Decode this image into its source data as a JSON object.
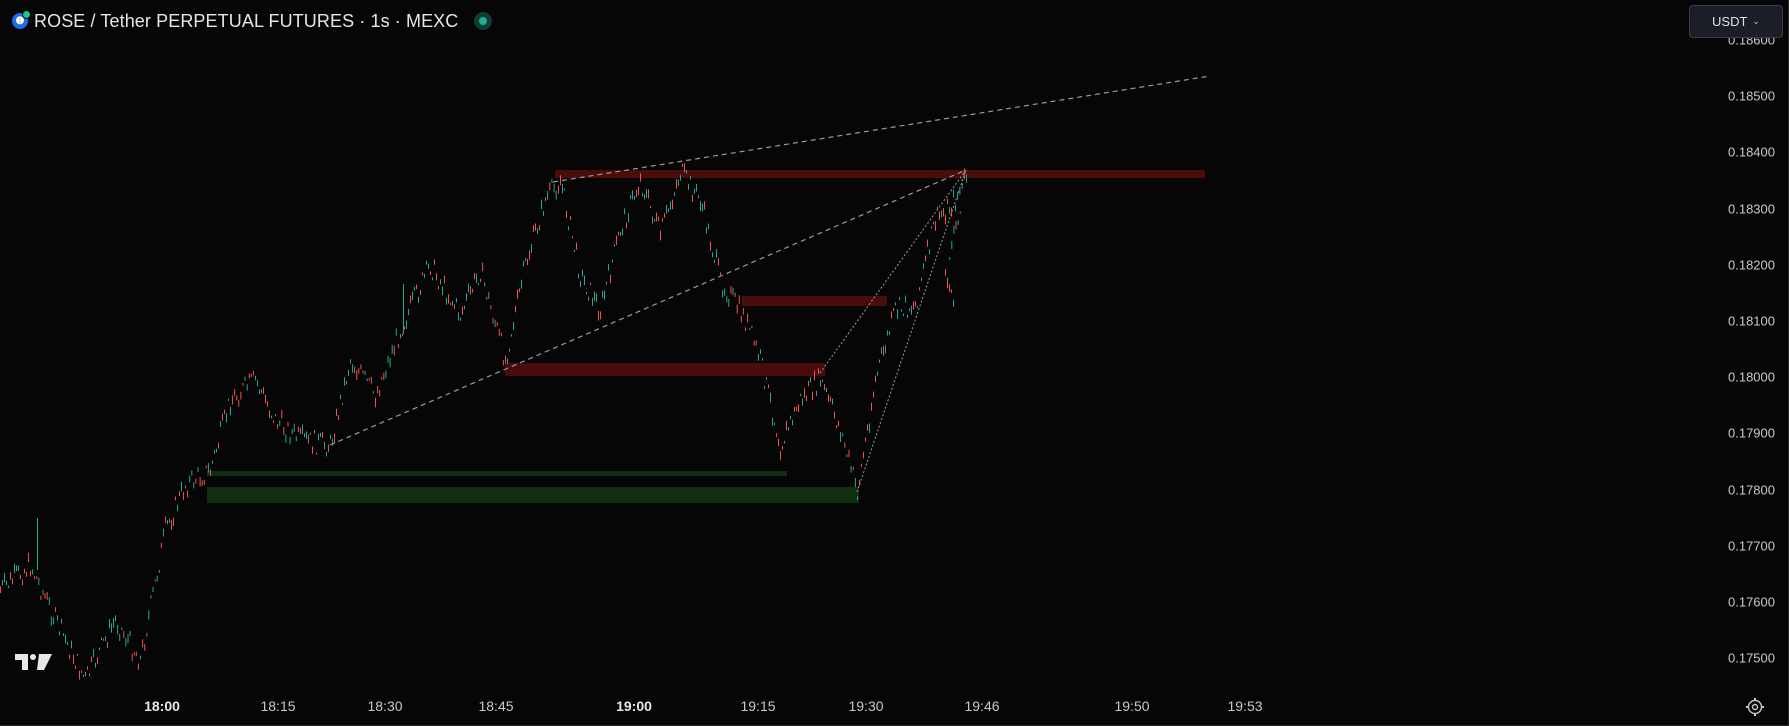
{
  "header": {
    "coin_icon": "rose-coin-icon",
    "coin_glyph": "❶",
    "symbol_title": "ROSE / Tether PERPETUAL FUTURES · 1s · MEXC",
    "live_indicator": "live-status-dot"
  },
  "price_axis": {
    "currency": "USDT",
    "ticks": [
      "0.18600",
      "0.18500",
      "0.18400",
      "0.18300",
      "0.18200",
      "0.18100",
      "0.18000",
      "0.17900",
      "0.17800",
      "0.17700",
      "0.17600",
      "0.17500"
    ]
  },
  "time_axis": {
    "ticks": [
      {
        "label": "18:00",
        "bold": true
      },
      {
        "label": "18:15",
        "bold": false
      },
      {
        "label": "18:30",
        "bold": false
      },
      {
        "label": "18:45",
        "bold": false
      },
      {
        "label": "19:00",
        "bold": true
      },
      {
        "label": "19:15",
        "bold": false
      },
      {
        "label": "19:30",
        "bold": false
      },
      {
        "label": "19:46",
        "bold": false
      },
      {
        "label": "19:50",
        "bold": false
      },
      {
        "label": "19:53",
        "bold": false
      }
    ]
  },
  "colors": {
    "background": "#060606",
    "up": "#26a69a",
    "down": "#ef5350",
    "supply_zone": "#4a0d0d",
    "demand_zone": "#0f2e12",
    "trendline": "#9a9a9a"
  },
  "icons": {
    "settings": "gear-icon",
    "logo": "tradingview-logo-icon"
  }
}
